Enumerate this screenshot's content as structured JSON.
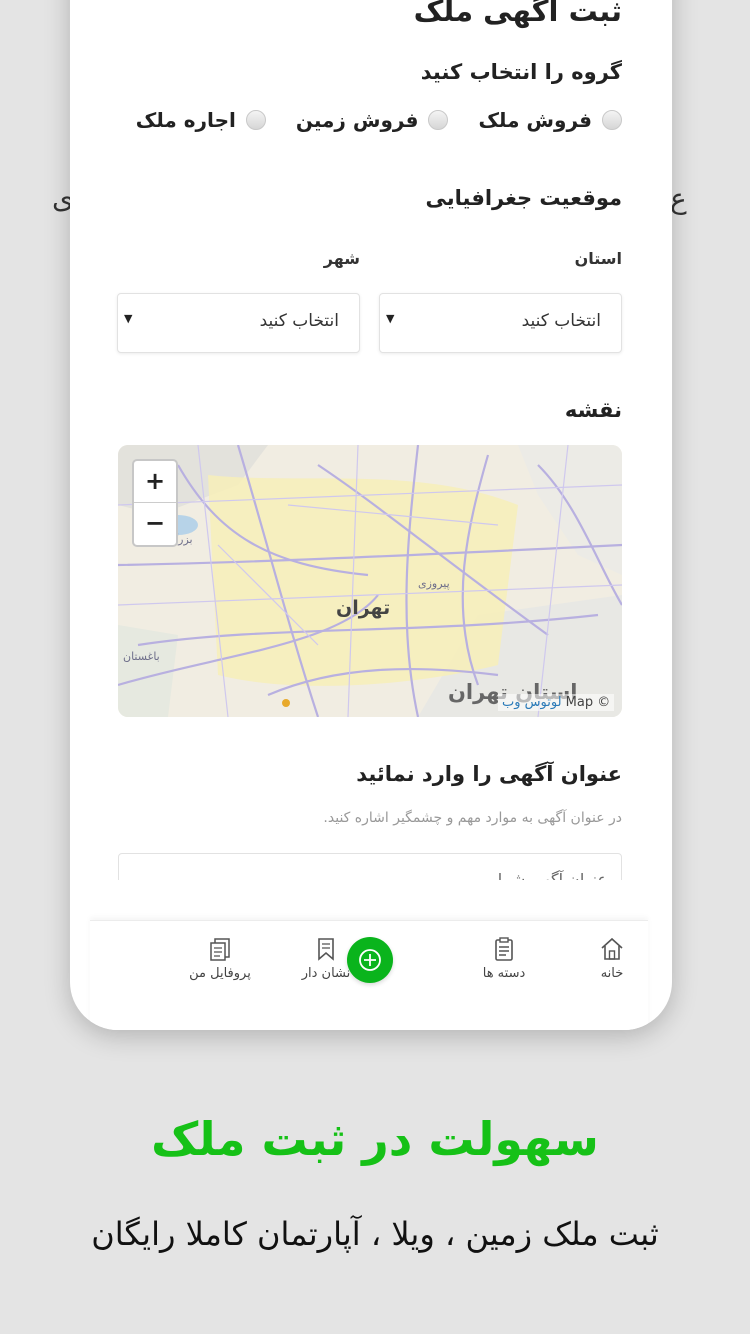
{
  "behind_text": {
    "left_fragment": "ع",
    "right_fragment": "ی"
  },
  "form": {
    "title": "ثبت آگهی ملک",
    "group_heading": "گروه را انتخاب کنید",
    "group_options": [
      "فروش ملک",
      "فروش زمین",
      "اجاره ملک"
    ],
    "location_heading": "موقعیت جغرافیایی",
    "province_label": "استان",
    "city_label": "شهر",
    "province_select_value": "انتخاب کنید",
    "city_select_value": "انتخاب کنید",
    "map_heading": "نقشه",
    "map": {
      "zoom_in": "+",
      "zoom_out": "−",
      "city_label": "تهران",
      "province_label": "استان تهران",
      "attribution_map": "Map ©",
      "attribution_link": "لوتوس وب"
    },
    "ad_title_heading": "عنوان آگهی را وارد نمائید",
    "ad_title_hint": "در عنوان آگهی به موارد مهم و چشمگیر اشاره کنید.",
    "ad_title_placeholder": "عنوان آگهی شما"
  },
  "bottom_nav": {
    "items": [
      {
        "label": "خانه",
        "icon": "home-icon"
      },
      {
        "label": "دسته ها",
        "icon": "clipboard-icon"
      },
      {
        "label": "",
        "icon": "add-circle-icon"
      },
      {
        "label": "نشان دار",
        "icon": "bookmark-icon"
      },
      {
        "label": "پروفایل من",
        "icon": "profile-icon"
      }
    ]
  },
  "caption": {
    "title": "سهولت در ثبت ملک",
    "subtitle": "ثبت ملک زمین ، ویلا ، آپارتمان کاملا رایگان"
  },
  "colors": {
    "accent_green": "#16c117",
    "fab_green": "#0ab41c",
    "background": "#e4e4e4"
  }
}
